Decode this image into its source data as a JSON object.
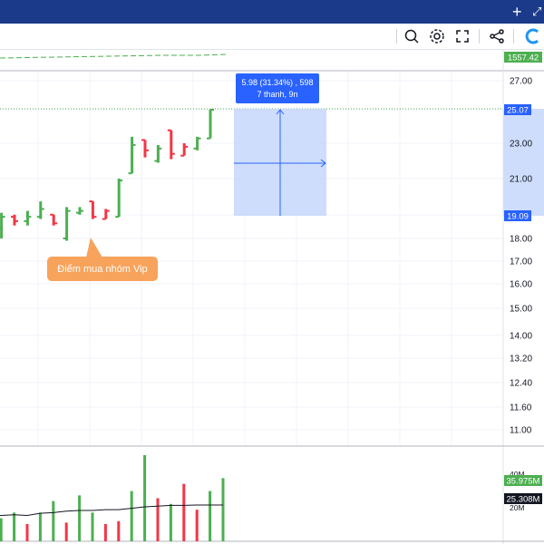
{
  "colors": {
    "up": "#4caf50",
    "down": "#f23645",
    "topbar": "#1b3a8a",
    "measure_fill": "#c9d9fb",
    "measure_label_bg": "#2962ff",
    "callout_bg": "#f7a35c",
    "grid": "#f0f3fa",
    "volume_ma": "#131722"
  },
  "topbar": {
    "plus_icon": "plus-icon",
    "expand_icon": "expand-icon"
  },
  "toolbar": {
    "icons": [
      "zoom-icon",
      "gear-icon",
      "fullscreen-icon",
      "share-icon",
      "logo-icon"
    ]
  },
  "price_axis": {
    "ticks": [
      "27.00",
      "25.07",
      "23.00",
      "21.00",
      "19.09",
      "18.00",
      "17.00",
      "16.00",
      "15.00",
      "14.00",
      "13.20",
      "12.40",
      "11.60",
      "11.00"
    ],
    "index_label": "1557.42",
    "high_label": "25.07",
    "low_label": "19.09"
  },
  "volume_axis": {
    "ticks": [
      "40M",
      "20M"
    ],
    "current_volume": "35.975M",
    "volume_ma": "25.308M"
  },
  "measure_tool": {
    "line1": "5.98 (31.34%) , 598",
    "line2": "7 thanh, 9n"
  },
  "callout": {
    "text": "Điểm mua nhóm Vip"
  },
  "chart_data": {
    "type": "bar",
    "note_ohlc": "open/high/low/close in price units",
    "bars": [
      {
        "o": 17.6,
        "h": 17.6,
        "l": 17.3,
        "c": 17.5,
        "up": true
      },
      {
        "o": 17.7,
        "h": 18.5,
        "l": 17.6,
        "c": 18.2,
        "up": true
      },
      {
        "o": 18.5,
        "h": 19.2,
        "l": 18.0,
        "c": 19.0,
        "up": true
      },
      {
        "o": 19.0,
        "h": 19.1,
        "l": 18.6,
        "c": 18.8,
        "up": false
      },
      {
        "o": 18.8,
        "h": 19.3,
        "l": 18.6,
        "c": 19.0,
        "up": true
      },
      {
        "o": 19.0,
        "h": 19.8,
        "l": 18.9,
        "c": 19.4,
        "up": true
      },
      {
        "o": 19.1,
        "h": 19.1,
        "l": 18.6,
        "c": 18.7,
        "up": false
      },
      {
        "o": 18.0,
        "h": 19.5,
        "l": 17.9,
        "c": 19.3,
        "up": true
      },
      {
        "o": 19.2,
        "h": 19.5,
        "l": 19.1,
        "c": 19.3,
        "up": true
      },
      {
        "o": 19.8,
        "h": 19.8,
        "l": 18.9,
        "c": 19.0,
        "up": false
      },
      {
        "o": 18.9,
        "h": 19.4,
        "l": 18.9,
        "c": 19.3,
        "up": false
      },
      {
        "o": 19.0,
        "h": 21.0,
        "l": 19.0,
        "c": 20.9,
        "up": true
      },
      {
        "o": 21.3,
        "h": 23.4,
        "l": 21.3,
        "c": 22.9,
        "up": true
      },
      {
        "o": 23.2,
        "h": 23.2,
        "l": 22.2,
        "c": 22.6,
        "up": false
      },
      {
        "o": 22.0,
        "h": 22.9,
        "l": 21.9,
        "c": 22.7,
        "up": true
      },
      {
        "o": 23.8,
        "h": 23.8,
        "l": 22.1,
        "c": 22.4,
        "up": false
      },
      {
        "o": 22.3,
        "h": 23.0,
        "l": 22.3,
        "c": 22.8,
        "up": false
      },
      {
        "o": 22.7,
        "h": 23.4,
        "l": 22.6,
        "c": 23.3,
        "up": true
      },
      {
        "o": 23.3,
        "h": 25.07,
        "l": 23.3,
        "c": 25.07,
        "up": true
      }
    ],
    "volumes": [
      {
        "v": 14,
        "up": true
      },
      {
        "v": 16,
        "up": true
      },
      {
        "v": 20,
        "up": true
      },
      {
        "v": 12,
        "up": false
      },
      {
        "v": 20,
        "up": true
      },
      {
        "v": 28,
        "up": true
      },
      {
        "v": 13,
        "up": false
      },
      {
        "v": 32,
        "up": true
      },
      {
        "v": 20,
        "up": true
      },
      {
        "v": 12,
        "up": false
      },
      {
        "v": 14,
        "up": false
      },
      {
        "v": 35,
        "up": true
      },
      {
        "v": 60,
        "up": true
      },
      {
        "v": 30,
        "up": false
      },
      {
        "v": 26,
        "up": true
      },
      {
        "v": 40,
        "up": false
      },
      {
        "v": 22,
        "up": false
      },
      {
        "v": 35,
        "up": true
      },
      {
        "v": 44,
        "up": true
      }
    ],
    "volume_ma_values": [
      17,
      18,
      18.5,
      18,
      19.5,
      20,
      21,
      21.5,
      21.5,
      22,
      22,
      23,
      24,
      24.5,
      25,
      25,
      25.3,
      25.3,
      25.3
    ],
    "ylim": [
      11,
      27
    ],
    "volume_ylim": [
      0,
      40
    ]
  }
}
